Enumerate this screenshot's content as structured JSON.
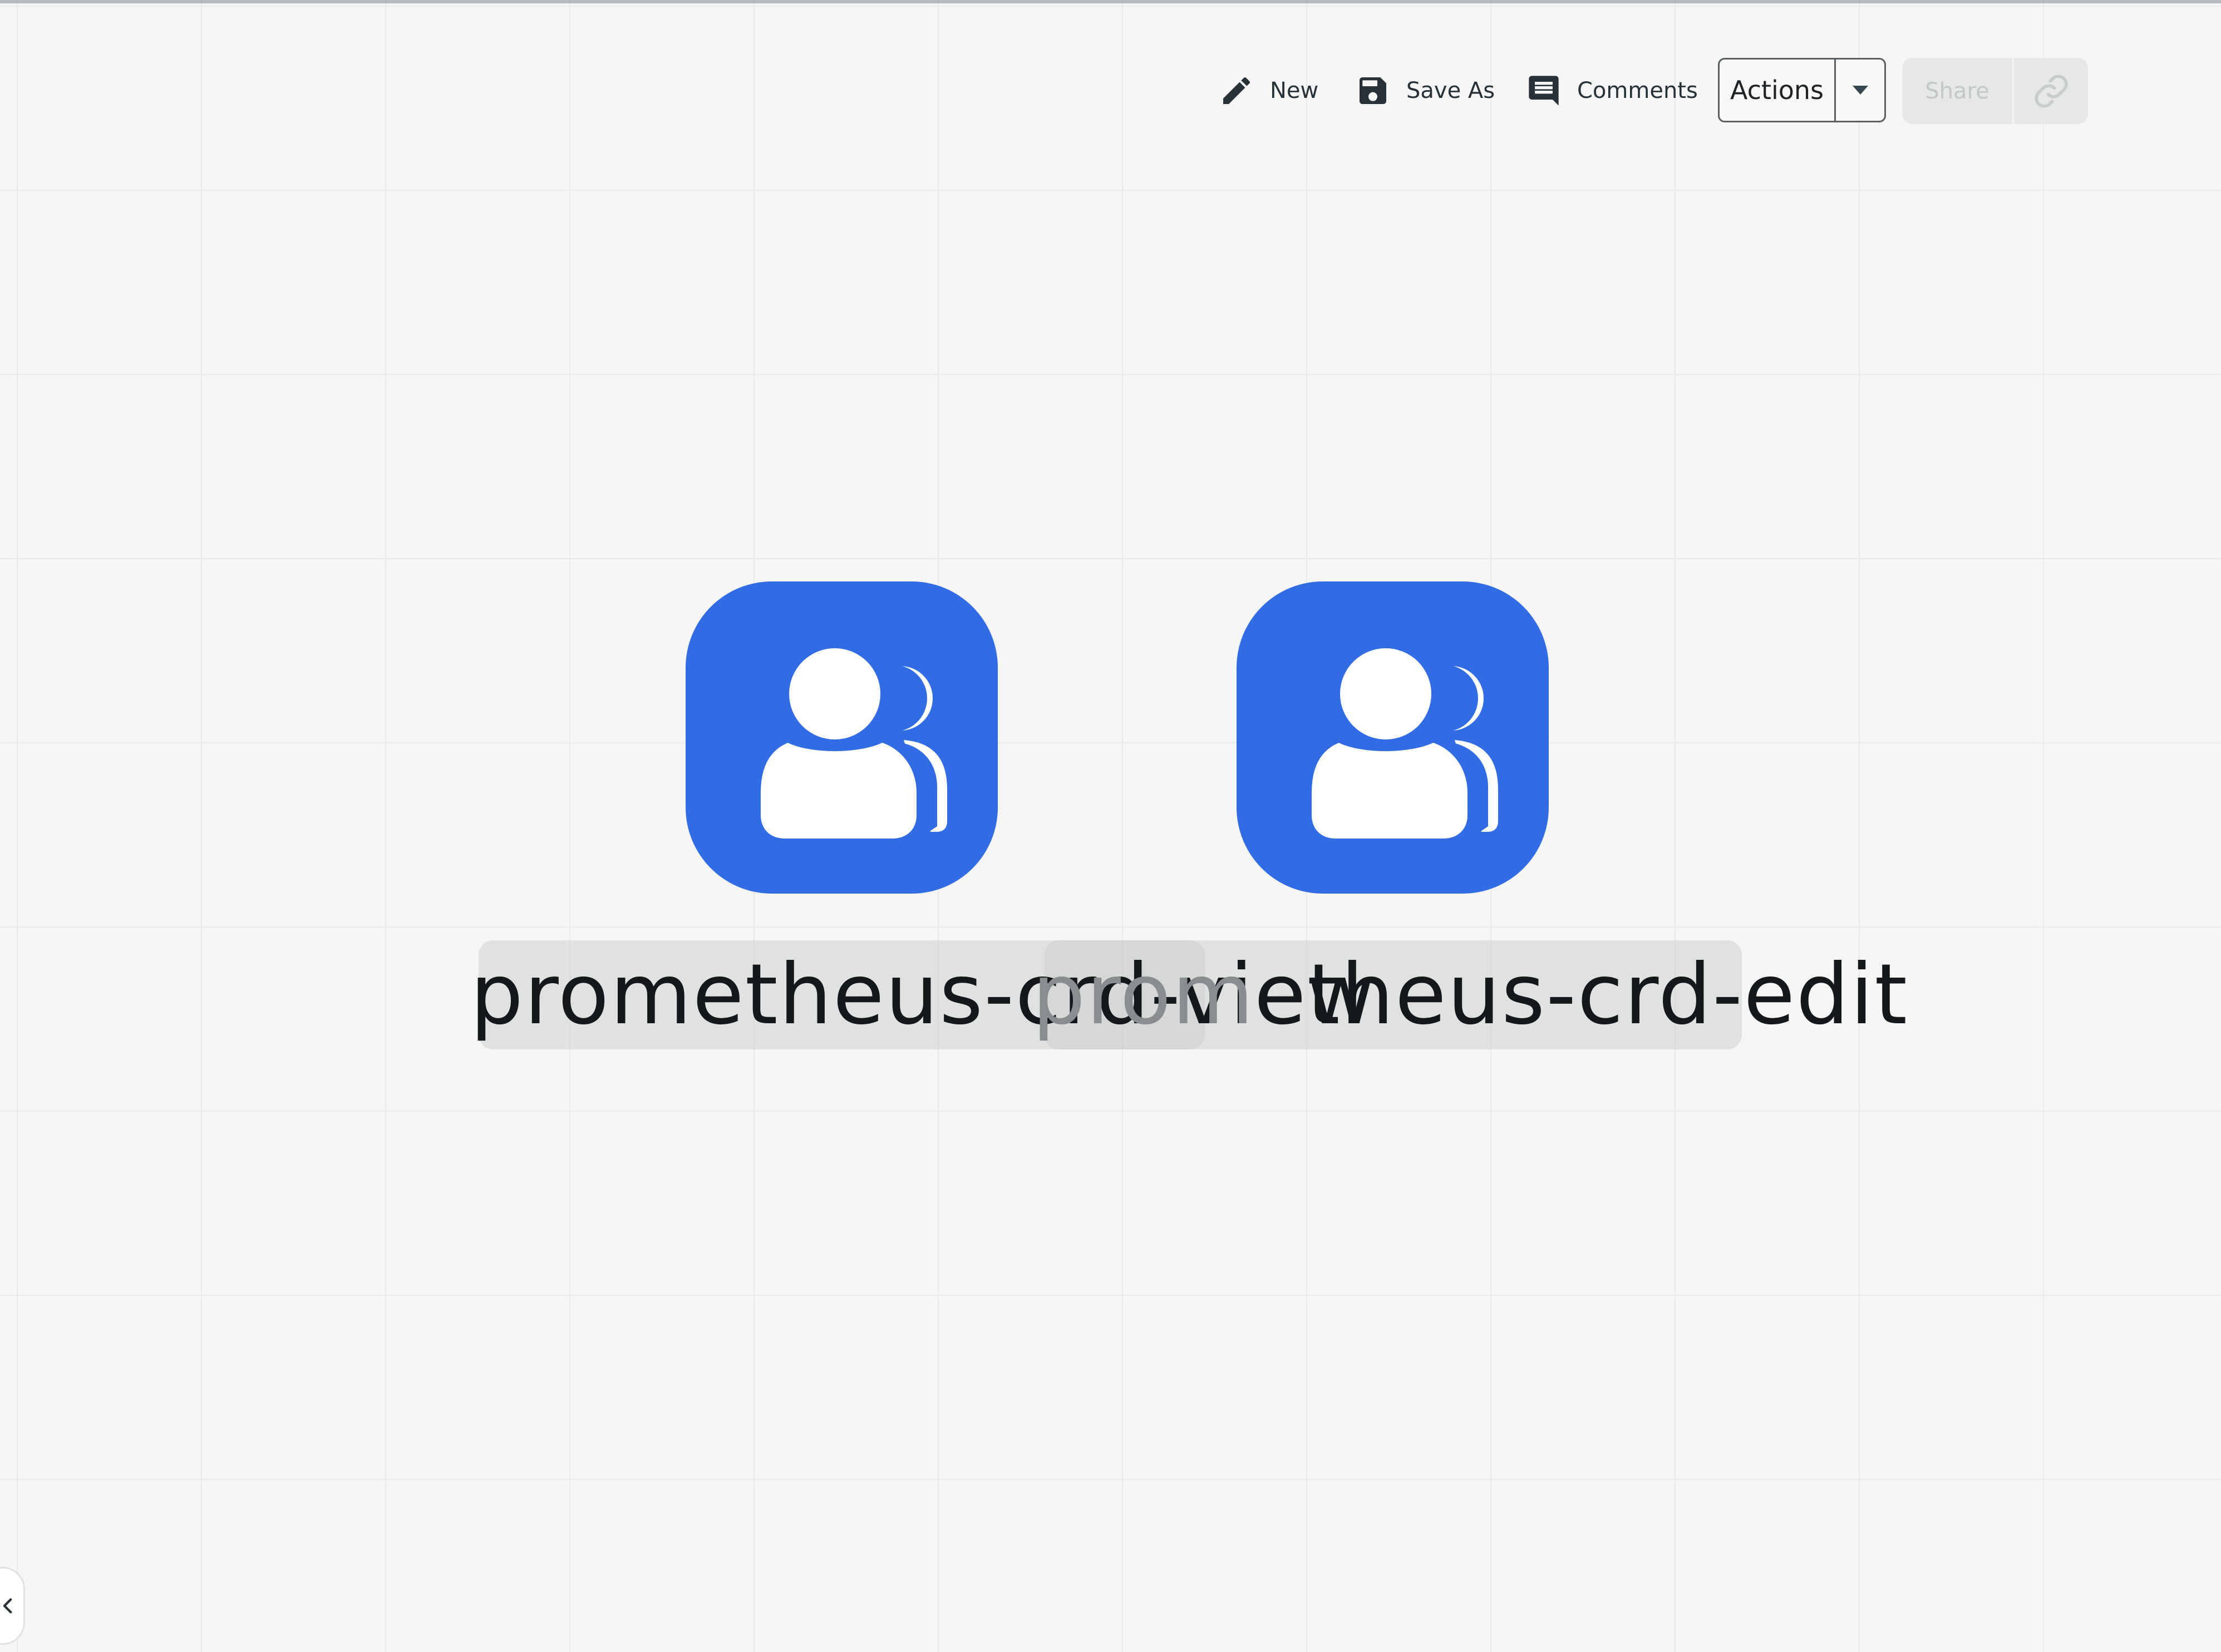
{
  "toolbar": {
    "new_label": "New",
    "new_icon": "pencil-icon",
    "save_as_label": "Save As",
    "save_as_icon": "floppy-disk-icon",
    "comments_label": "Comments",
    "comments_icon": "comment-icon",
    "actions_label": "Actions",
    "actions_icon": "caret-down-icon",
    "share_label": "Share",
    "share_icon": "link-icon"
  },
  "canvas": {
    "nodes": [
      {
        "label": "prometheus-crd-view",
        "icon": "user-group-icon"
      },
      {
        "label": "prometheus-crd-edit",
        "icon": "user-group-icon"
      }
    ],
    "edit_label_faded_part": "prom",
    "edit_label_rest": "etheus-crd-edit"
  },
  "sidebar": {
    "toggle_icon": "chevron-left-icon"
  },
  "colors": {
    "node_blue": "#326ce5",
    "canvas_bg": "#f5f6f5",
    "text_dark": "#263238"
  }
}
